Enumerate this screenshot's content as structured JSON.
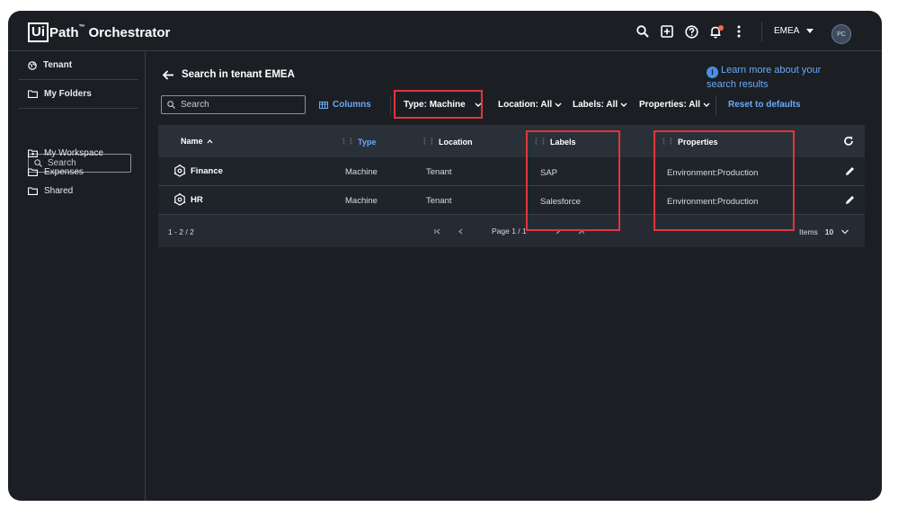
{
  "header": {
    "logo_ui": "Ui",
    "logo_path": "Path",
    "logo_tm": "™",
    "logo_product": "Orchestrator",
    "tenant": "EMEA",
    "avatar_initials": "PC"
  },
  "sidebar": {
    "tenant_label": "Tenant",
    "my_folders_label": "My Folders",
    "search_placeholder": "Search",
    "items": [
      {
        "label": "My Workspace"
      },
      {
        "label": "Expenses"
      },
      {
        "label": "Shared"
      }
    ]
  },
  "main": {
    "title": "Search in tenant EMEA",
    "learn_more": "Learn more about your search results",
    "search_placeholder": "Search",
    "columns_label": "Columns",
    "filters": {
      "type": "Type: Machine",
      "location": "Location: All",
      "labels": "Labels: All",
      "properties": "Properties: All"
    },
    "reset_label": "Reset to defaults",
    "table": {
      "columns": [
        "Name",
        "Type",
        "Location",
        "Labels",
        "Properties"
      ],
      "rows": [
        {
          "name": "Finance",
          "type": "Machine",
          "location": "Tenant",
          "labels": "SAP",
          "properties": "Environment:Production"
        },
        {
          "name": "HR",
          "type": "Machine",
          "location": "Tenant",
          "labels": "Salesforce",
          "properties": "Environment:Production"
        }
      ],
      "range": "1 - 2 / 2",
      "page": "Page 1 / 1",
      "items_label": "Items",
      "items_per_page": "10"
    }
  },
  "colors": {
    "background": "#1b1f24",
    "accent": "#6aa9f7",
    "highlight": "#e0363b"
  }
}
